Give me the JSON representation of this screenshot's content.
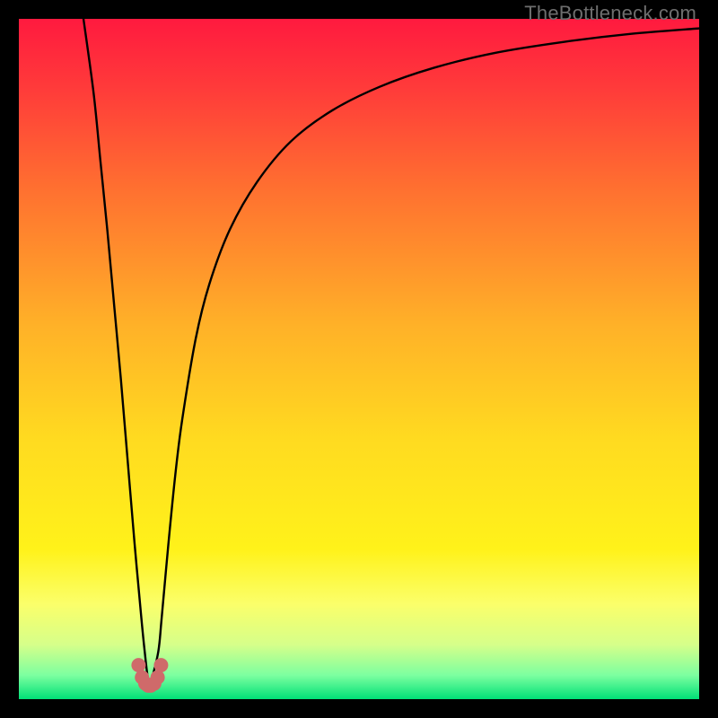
{
  "watermark": "TheBottleneck.com",
  "chart_data": {
    "type": "line",
    "title": "",
    "xlabel": "",
    "ylabel": "",
    "xlim": [
      0,
      100
    ],
    "ylim": [
      0,
      100
    ],
    "background_gradient": {
      "stops": [
        {
          "offset": 0.0,
          "color": "#ff1a3f"
        },
        {
          "offset": 0.1,
          "color": "#ff3a3a"
        },
        {
          "offset": 0.25,
          "color": "#ff7030"
        },
        {
          "offset": 0.45,
          "color": "#ffb128"
        },
        {
          "offset": 0.62,
          "color": "#ffdb20"
        },
        {
          "offset": 0.78,
          "color": "#fff21a"
        },
        {
          "offset": 0.86,
          "color": "#fbff6a"
        },
        {
          "offset": 0.92,
          "color": "#d6ff8a"
        },
        {
          "offset": 0.965,
          "color": "#7cffa0"
        },
        {
          "offset": 1.0,
          "color": "#00e077"
        }
      ]
    },
    "series": [
      {
        "name": "bottleneck-curve",
        "x": [
          9.5,
          11,
          12,
          13,
          14,
          15,
          16,
          17,
          18,
          18.5,
          19,
          19.5,
          20.5,
          21,
          22,
          23,
          24,
          26,
          28,
          31,
          35,
          40,
          46,
          53,
          61,
          70,
          80,
          90,
          100
        ],
        "values": [
          100,
          89,
          79,
          69,
          58,
          47,
          35,
          23,
          12,
          7,
          3,
          3,
          7,
          12,
          23,
          33,
          41,
          53,
          61,
          69,
          76,
          82,
          86.5,
          90,
          92.8,
          95,
          96.6,
          97.8,
          98.6
        ]
      }
    ],
    "markers": {
      "name": "near-zero-cluster",
      "color": "#cf6a6a",
      "points": [
        {
          "x": 17.6,
          "y": 5.0
        },
        {
          "x": 18.1,
          "y": 3.2
        },
        {
          "x": 18.6,
          "y": 2.3
        },
        {
          "x": 19.0,
          "y": 2.0
        },
        {
          "x": 19.4,
          "y": 2.0
        },
        {
          "x": 19.9,
          "y": 2.3
        },
        {
          "x": 20.4,
          "y": 3.2
        },
        {
          "x": 20.9,
          "y": 5.0
        }
      ]
    }
  }
}
